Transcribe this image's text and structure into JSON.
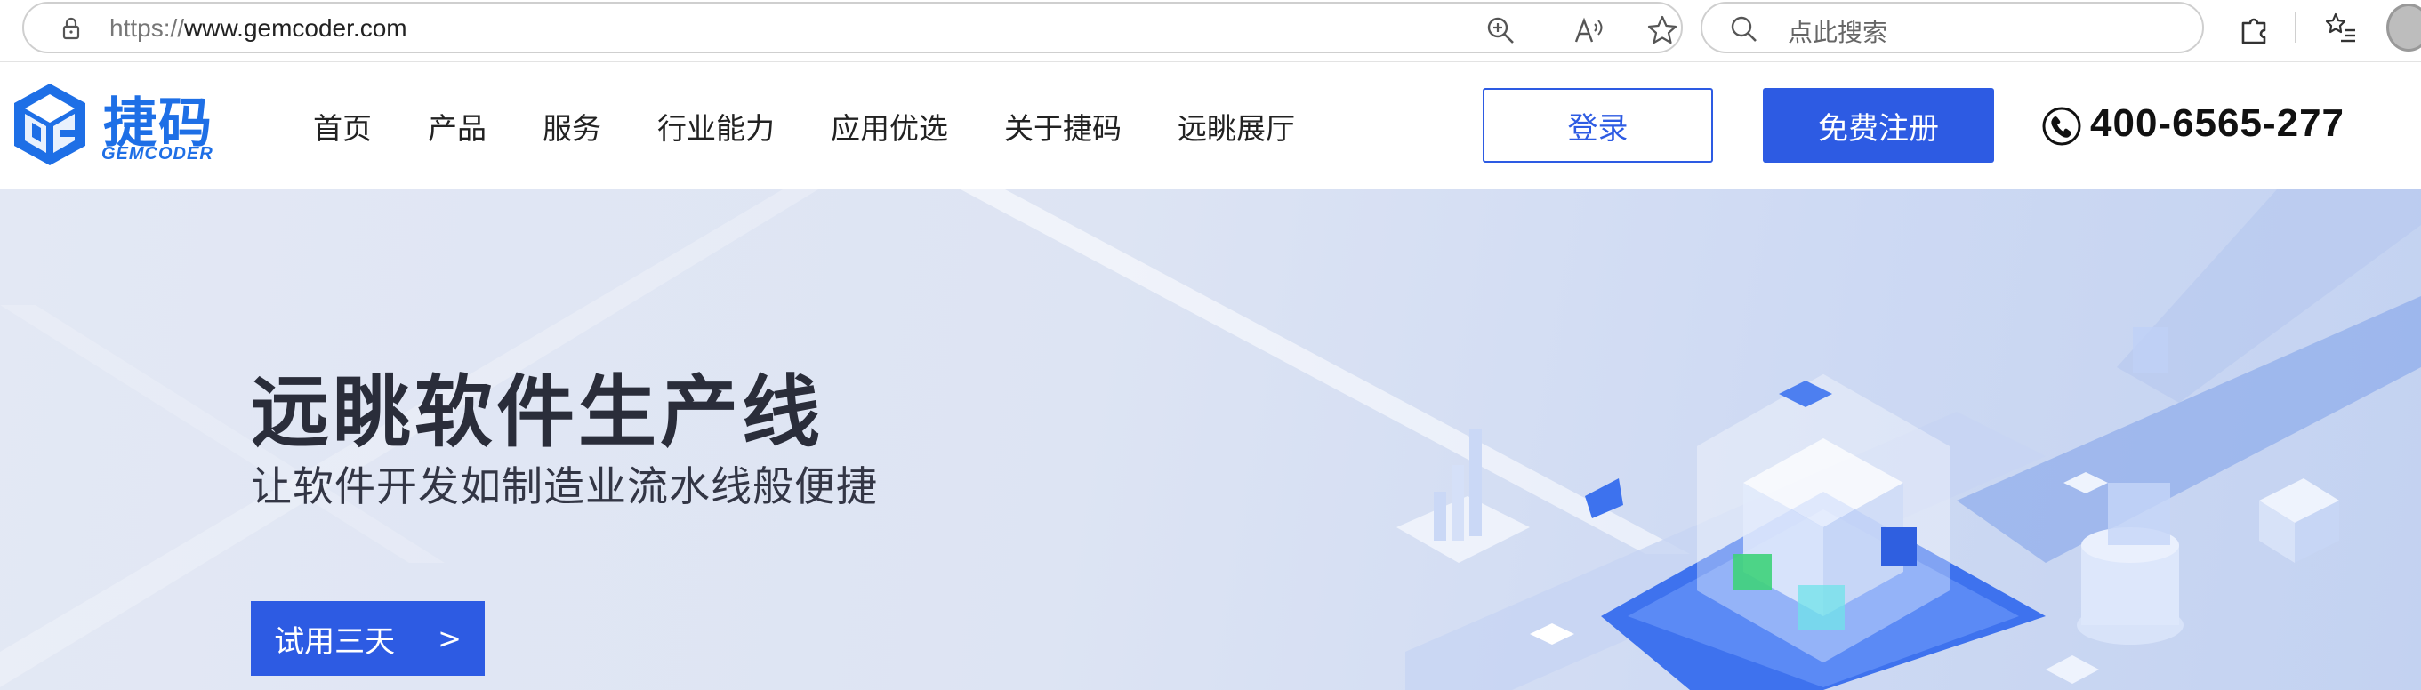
{
  "browser": {
    "url_protocol": "https://",
    "url_host": "www.gemcoder.com",
    "search_placeholder": "点此搜索",
    "toolbar_icons": [
      "zoom-icon",
      "read-aloud-icon",
      "favorite-star-icon",
      "extensions-icon",
      "favorites-list-icon"
    ]
  },
  "header": {
    "logo_cn": "捷码",
    "logo_en": "GEMCODER",
    "nav": [
      "首页",
      "产品",
      "服务",
      "行业能力",
      "应用优选",
      "关于捷码",
      "远眺展厅"
    ],
    "login_label": "登录",
    "register_label": "免费注册",
    "phone": "400-6565-277"
  },
  "hero": {
    "title": "远眺软件生产线",
    "subtitle": "让软件开发如制造业流水线般便捷",
    "cta_label": "试用三天",
    "cta_arrow": ">"
  },
  "colors": {
    "brand_blue": "#1e6fe6",
    "button_blue": "#2d5be3",
    "hero_bg": "#dde4f3"
  }
}
